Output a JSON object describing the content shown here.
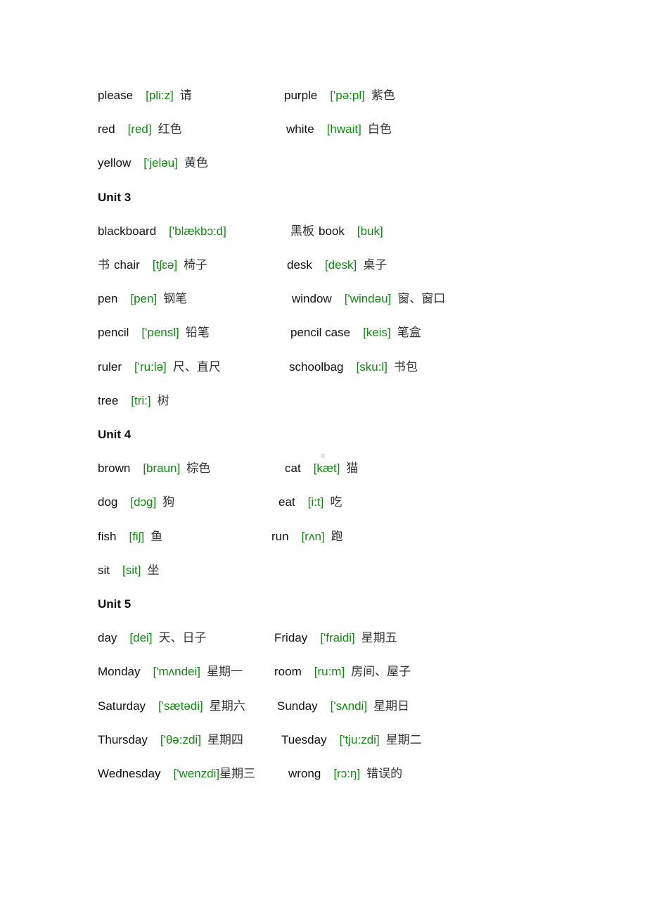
{
  "lines": [
    {
      "left": [
        {
          "t": "please",
          "k": "word"
        },
        {
          "t": "[pli:z]",
          "k": "ipa"
        },
        {
          "t": "请",
          "k": "zh"
        }
      ],
      "right": [
        {
          "t": "purple",
          "k": "word"
        },
        {
          "t": "['pə:pl]",
          "k": "ipa"
        },
        {
          "t": "紫色",
          "k": "zh"
        }
      ]
    },
    {
      "left": [
        {
          "t": "red",
          "k": "word"
        },
        {
          "t": "[red]",
          "k": "ipa"
        },
        {
          "t": "红色",
          "k": "zh"
        }
      ],
      "right": [
        {
          "t": "white",
          "k": "word"
        },
        {
          "t": "[hwait]",
          "k": "ipa"
        },
        {
          "t": "白色",
          "k": "zh"
        }
      ]
    },
    {
      "left": [
        {
          "t": "yellow",
          "k": "word"
        },
        {
          "t": "['jeləu]",
          "k": "ipa"
        },
        {
          "t": "黄色",
          "k": "zh"
        }
      ],
      "right": []
    },
    {
      "heading": "Unit 3"
    },
    {
      "left": [
        {
          "t": "blackboard",
          "k": "word"
        },
        {
          "t": "['blækbɔ:d]",
          "k": "ipa"
        }
      ],
      "right": [
        {
          "t": "黑板",
          "k": "zh"
        },
        {
          "t": "book",
          "k": "word"
        },
        {
          "t": "[buk]",
          "k": "ipa"
        }
      ]
    },
    {
      "left": [
        {
          "t": "书",
          "k": "zh"
        },
        {
          "t": "chair",
          "k": "word"
        },
        {
          "t": "[tʃɛə]",
          "k": "ipa"
        },
        {
          "t": "椅子",
          "k": "zh"
        }
      ],
      "right": [
        {
          "t": "desk",
          "k": "word"
        },
        {
          "t": "[desk]",
          "k": "ipa"
        },
        {
          "t": "桌子",
          "k": "zh"
        }
      ]
    },
    {
      "left": [
        {
          "t": "pen",
          "k": "word"
        },
        {
          "t": "[pen]",
          "k": "ipa"
        },
        {
          "t": "钢笔",
          "k": "zh"
        }
      ],
      "right": [
        {
          "t": "window",
          "k": "word"
        },
        {
          "t": "['windəu]",
          "k": "ipa"
        },
        {
          "t": "窗、窗口",
          "k": "zh"
        }
      ]
    },
    {
      "left": [
        {
          "t": "pencil",
          "k": "word"
        },
        {
          "t": "['pensl]",
          "k": "ipa"
        },
        {
          "t": "铅笔",
          "k": "zh"
        }
      ],
      "right": [
        {
          "t": "pencil case",
          "k": "word"
        },
        {
          "t": "[keis]",
          "k": "ipa"
        },
        {
          "t": "笔盒",
          "k": "zh"
        }
      ]
    },
    {
      "left": [
        {
          "t": "ruler",
          "k": "word"
        },
        {
          "t": "['ru:lə]",
          "k": "ipa"
        },
        {
          "t": "尺、直尺",
          "k": "zh"
        }
      ],
      "right": [
        {
          "t": "schoolbag",
          "k": "word"
        },
        {
          "t": "[sku:l]",
          "k": "ipa"
        },
        {
          "t": "书包",
          "k": "zh"
        }
      ]
    },
    {
      "left": [
        {
          "t": "tree",
          "k": "word"
        },
        {
          "t": "[tri:]",
          "k": "ipa"
        },
        {
          "t": "树",
          "k": "zh"
        }
      ],
      "right": []
    },
    {
      "heading": "Unit 4"
    },
    {
      "left": [
        {
          "t": "brown",
          "k": "word"
        },
        {
          "t": "[braun]",
          "k": "ipa"
        },
        {
          "t": "棕色",
          "k": "zh"
        }
      ],
      "right": [
        {
          "t": "cat",
          "k": "word"
        },
        {
          "t": "[kæt]",
          "k": "ipa"
        },
        {
          "t": "猫",
          "k": "zh"
        }
      ]
    },
    {
      "left": [
        {
          "t": "dog",
          "k": "word"
        },
        {
          "t": "[dɔg]",
          "k": "ipa"
        },
        {
          "t": "狗",
          "k": "zh"
        }
      ],
      "right": [
        {
          "t": "eat",
          "k": "word"
        },
        {
          "t": "[i:t]",
          "k": "ipa"
        },
        {
          "t": "吃",
          "k": "zh"
        }
      ]
    },
    {
      "left": [
        {
          "t": "fish",
          "k": "word"
        },
        {
          "t": "[fiʃ]",
          "k": "ipa"
        },
        {
          "t": "鱼",
          "k": "zh"
        }
      ],
      "right": [
        {
          "t": "run",
          "k": "word"
        },
        {
          "t": "[rʌn]",
          "k": "ipa"
        },
        {
          "t": "跑",
          "k": "zh"
        }
      ]
    },
    {
      "left": [
        {
          "t": "sit",
          "k": "word"
        },
        {
          "t": "[sit]",
          "k": "ipa"
        },
        {
          "t": "坐",
          "k": "zh"
        }
      ],
      "right": []
    },
    {
      "heading": "Unit 5"
    },
    {
      "left": [
        {
          "t": "day",
          "k": "word"
        },
        {
          "t": "[dei]",
          "k": "ipa"
        },
        {
          "t": "天、日子",
          "k": "zh"
        }
      ],
      "right": [
        {
          "t": "Friday",
          "k": "word"
        },
        {
          "t": "['fraidi]",
          "k": "ipa"
        },
        {
          "t": "星期五",
          "k": "zh"
        }
      ]
    },
    {
      "left": [
        {
          "t": "Monday",
          "k": "word"
        },
        {
          "t": "['mʌndei]",
          "k": "ipa"
        },
        {
          "t": "星期一",
          "k": "zh"
        }
      ],
      "right": [
        {
          "t": "room",
          "k": "word"
        },
        {
          "t": "[ru:m]",
          "k": "ipa"
        },
        {
          "t": "房间、屋子",
          "k": "zh"
        }
      ]
    },
    {
      "left": [
        {
          "t": "Saturday",
          "k": "word"
        },
        {
          "t": "['sætədi]",
          "k": "ipa"
        },
        {
          "t": "星期六",
          "k": "zh"
        }
      ],
      "right": [
        {
          "t": "Sunday",
          "k": "word"
        },
        {
          "t": "['sʌndi]",
          "k": "ipa"
        },
        {
          "t": "星期日",
          "k": "zh"
        }
      ]
    },
    {
      "left": [
        {
          "t": "Thursday",
          "k": "word"
        },
        {
          "t": "['θə:zdi]",
          "k": "ipa"
        },
        {
          "t": "星期四",
          "k": "zh"
        }
      ],
      "right": [
        {
          "t": "Tuesday",
          "k": "word"
        },
        {
          "t": "['tju:zdi]",
          "k": "ipa"
        },
        {
          "t": "星期二",
          "k": "zh"
        }
      ]
    },
    {
      "left": [
        {
          "t": "Wednesday",
          "k": "word"
        },
        {
          "t": "['wenzdi]",
          "k": "ipa"
        },
        {
          "t": "星期三",
          "k": "zh"
        }
      ],
      "right": [
        {
          "t": "wrong",
          "k": "word"
        },
        {
          "t": "[rɔ:ŋ]",
          "k": "ipa"
        },
        {
          "t": "错误的",
          "k": "zh"
        }
      ]
    }
  ]
}
